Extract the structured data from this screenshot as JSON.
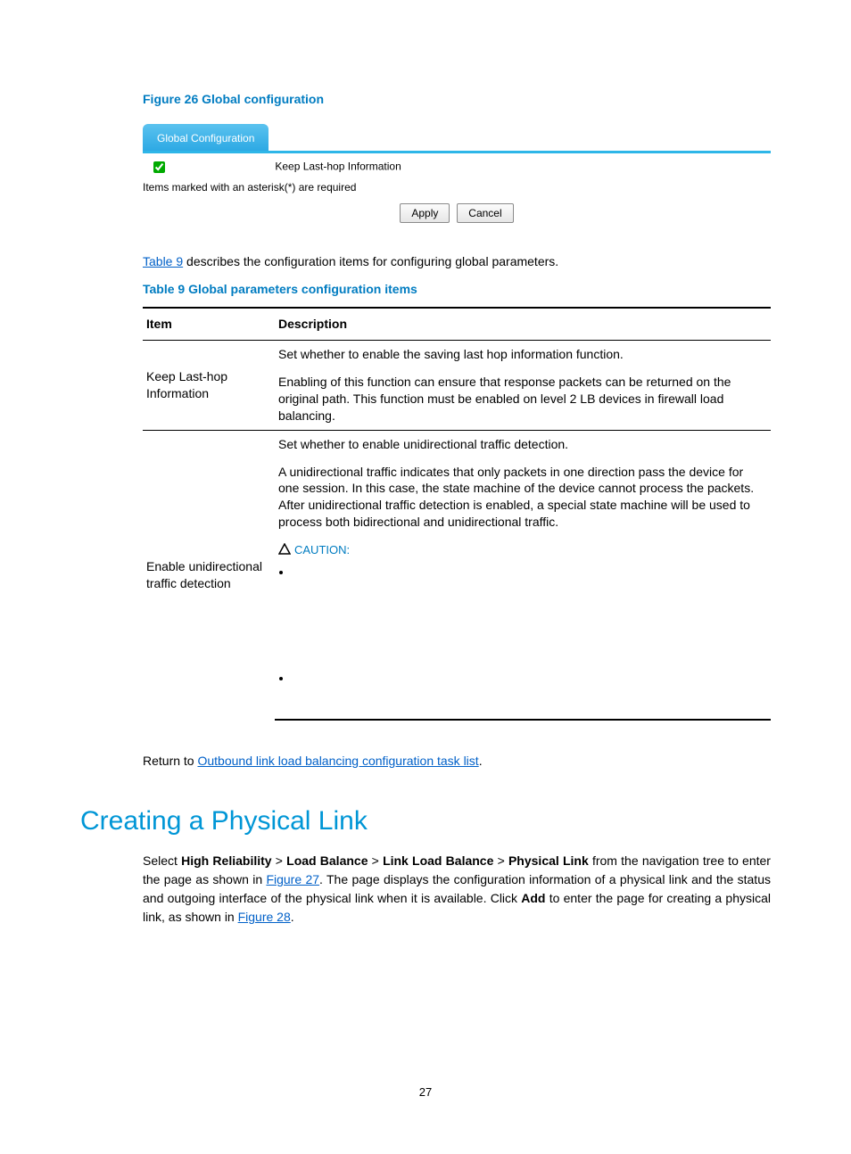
{
  "figure": {
    "caption": "Figure 26 Global configuration"
  },
  "screenshot": {
    "tab_label": "Global Configuration",
    "checkbox_label": "Keep Last-hop Information",
    "required_note": "Items marked with an asterisk(*) are required",
    "apply": "Apply",
    "cancel": "Cancel"
  },
  "para_table_ref": {
    "link": "Table 9",
    "rest": " describes the configuration items for configuring global parameters."
  },
  "table": {
    "caption": "Table 9 Global parameters configuration items",
    "headers": {
      "item": "Item",
      "desc": "Description"
    },
    "rows": [
      {
        "item": "Keep Last-hop Information",
        "desc1": "Set whether to enable the saving last hop information function.",
        "desc2": "Enabling of this function can ensure that response packets can be returned on the original path. This function must be enabled on level 2 LB devices in firewall load balancing."
      },
      {
        "item": "Enable unidirectional traffic detection",
        "desc1": "Set whether to enable unidirectional traffic detection.",
        "desc2": "A unidirectional traffic indicates that only packets in one direction pass the device for one session. In this case, the state machine of the device cannot process the packets. After unidirectional traffic detection is enabled, a special state machine will be used to process both bidirectional and unidirectional traffic.",
        "caution": "CAUTION:"
      }
    ]
  },
  "return": {
    "prefix": "Return to ",
    "link": "Outbound link load balancing configuration task list",
    "suffix": "."
  },
  "h2": "Creating a Physical Link",
  "body": {
    "select": "Select ",
    "p1": "High Reliability",
    "gt": " > ",
    "p2": "Load Balance",
    "p3": "Link Load Balance",
    "p4": "Physical Link",
    "after1": " from the navigation tree to enter the page as shown in ",
    "link27": "Figure 27",
    "after2": ". The page displays the configuration information of a physical link and the status and outgoing interface of the physical link when it is available. Click ",
    "add": "Add",
    "after3": " to enter the page for creating a physical link, as shown in ",
    "link28": "Figure 28",
    "after4": "."
  },
  "page_number": "27"
}
